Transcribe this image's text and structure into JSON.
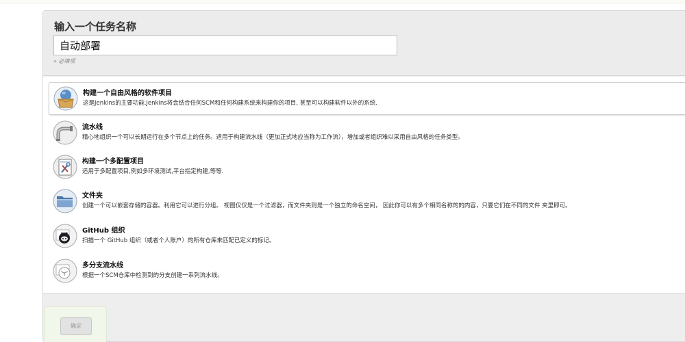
{
  "header": {
    "title": "输入一个任务名称",
    "input_value": "自动部署",
    "required_hint": "» 必填项"
  },
  "project_types": [
    {
      "title": "构建一个自由风格的软件项目",
      "description": "这是Jenkins的主要功能.Jenkins将会结合任何SCM和任何构建系统来构建你的项目, 甚至可以构建软件以外的系统.",
      "icon": "freestyle-project-icon",
      "selected": true
    },
    {
      "title": "流水线",
      "description": "精心地组织一个可以长期运行在多个节点上的任务。适用于构建流水线（更加正式地应当称为工作流），增加或者组织难以采用自由风格的任务类型。",
      "icon": "pipeline-icon",
      "selected": false
    },
    {
      "title": "构建一个多配置项目",
      "description": "适用于多配置项目,例如多环境测试,平台指定构建,等等.",
      "icon": "multi-configuration-icon",
      "selected": false
    },
    {
      "title": "文件夹",
      "description": "创建一个可以嵌套存储的容器。利用它可以进行分组。 视图仅仅是一个过滤器，而文件夹则是一个独立的命名空间， 因此你可以有多个相同名称的的内容，只要它们在不同的文件 夹里即可。",
      "icon": "folder-icon",
      "selected": false
    },
    {
      "title": "GitHub 组织",
      "description": "扫描一个 GitHub 组织（或者个人账户）的所有仓库来匹配已定义的标记。",
      "icon": "github-icon",
      "selected": false
    },
    {
      "title": "多分支流水线",
      "description": "根据一个SCM仓库中检测到的分支创建一系列流水线。",
      "icon": "multibranch-pipeline-icon",
      "selected": false
    }
  ],
  "footer": {
    "ok_label": "确定"
  }
}
